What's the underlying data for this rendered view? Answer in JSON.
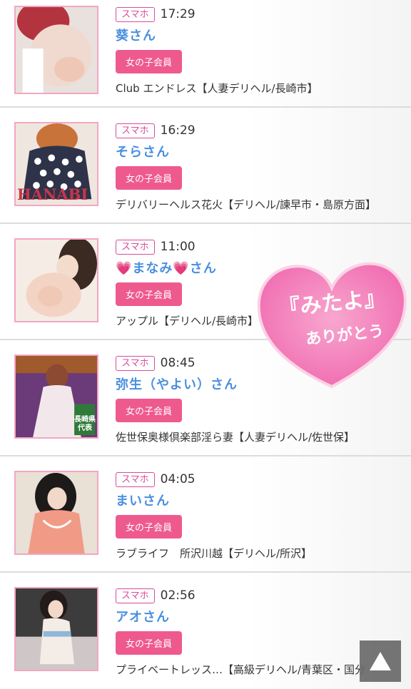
{
  "entries": [
    {
      "badge": "スマホ",
      "time": "17:29",
      "name": "葵さん",
      "member": "女の子会員",
      "shop": "Club エンドレス【人妻デリヘル/長崎市】"
    },
    {
      "badge": "スマホ",
      "time": "16:29",
      "name": "そらさん",
      "member": "女の子会員",
      "shop": "デリバリーヘルス花火【デリヘル/諫早市・島原方面】",
      "thumb_text": "HANABI"
    },
    {
      "badge": "スマホ",
      "time": "11:00",
      "name": "💗まなみ💗さん",
      "member": "女の子会員",
      "shop": "アップル【デリヘル/長崎市】"
    },
    {
      "badge": "スマホ",
      "time": "08:45",
      "name": "弥生（やよい）さん",
      "member": "女の子会員",
      "shop": "佐世保奥様倶楽部淫ら妻【人妻デリヘル/佐世保】",
      "thumb_text": "長崎県 代表"
    },
    {
      "badge": "スマホ",
      "time": "04:05",
      "name": "まいさん",
      "member": "女の子会員",
      "shop": "ラブライフ　所沢川越【デリヘル/所沢】"
    },
    {
      "badge": "スマホ",
      "time": "02:56",
      "name": "アオさん",
      "member": "女の子会員",
      "shop": "プライベートレッス…【高級デリヘル/青葉区・国分"
    }
  ],
  "overlay": {
    "line1": "『みたよ』",
    "line2": "ありがとう"
  },
  "colors": {
    "accent_pink": "#ee5a8e",
    "name_blue": "#4a8fe0",
    "badge_magenta": "#d84c9b",
    "heart_pink": "#f47fb9"
  },
  "icons": {
    "scroll_top": "triangle-up-icon"
  }
}
